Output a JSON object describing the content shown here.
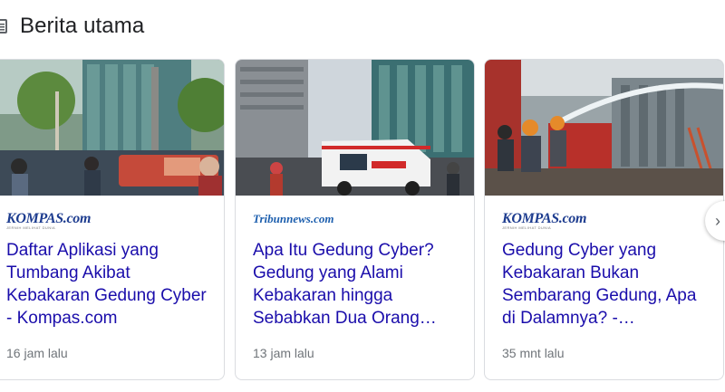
{
  "section": {
    "title": "Berita utama",
    "icon": "news-icon"
  },
  "cards": [
    {
      "source": "KOMPAS.com",
      "source_sub": "JERNIH MELIHAT DUNIA",
      "headline": "Daftar Aplikasi yang Tumbang Akibat Kebakaran Gedung Cyber - Kompas.com",
      "time": "16 jam lalu"
    },
    {
      "source": "Tribunnews.com",
      "headline": "Apa Itu Gedung Cyber? Gedung yang Alami Kebakaran hingga Sebabkan Dua Orang…",
      "time": "13 jam lalu"
    },
    {
      "source": "KOMPAS.com",
      "source_sub": "JERNIH MELIHAT DUNIA",
      "headline": "Gedung Cyber yang Kebakaran Bukan Sembarang Gedung, Apa di Dalamnya? -…",
      "time": "35 mnt lalu"
    }
  ],
  "carousel": {
    "next_icon": "chevron-right-icon",
    "next_label": "›"
  }
}
